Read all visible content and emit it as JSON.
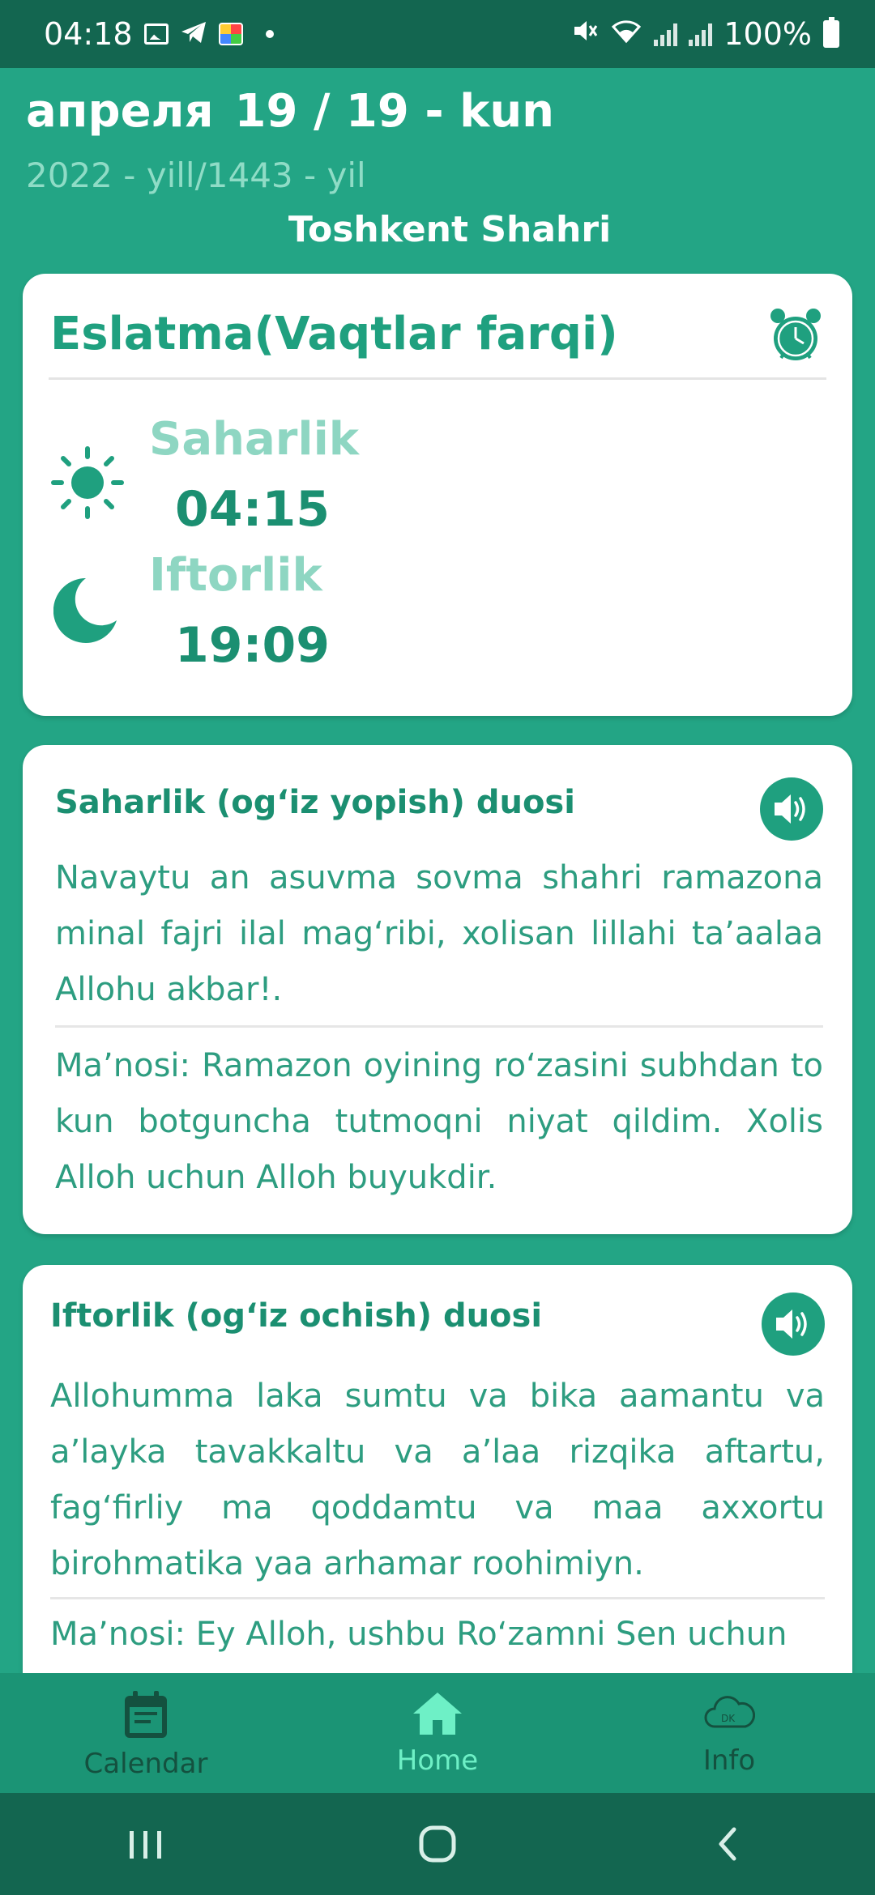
{
  "status_bar": {
    "time": "04:18",
    "battery": "100%",
    "icons": [
      "gallery-icon",
      "telegram-icon",
      "chat-app-icon",
      "notification-dot",
      "mute-icon",
      "wifi-icon",
      "signal-icon",
      "battery-icon"
    ]
  },
  "header": {
    "month": "апреля",
    "day": "19 / 19 - kun",
    "year": "2022 - yill/1443 - yil",
    "city": "Toshkent Shahri"
  },
  "reminder": {
    "title": "Eslatma(Vaqtlar farqi)",
    "saharlik_label": "Saharlik",
    "saharlik_time": "04:15",
    "iftorlik_label": "Iftorlik",
    "iftorlik_time": "19:09"
  },
  "duo_saharlik": {
    "title": "Saharlik (og‘iz yopish) duosi",
    "text": "Navaytu an asuvma sovma shahri ramazona minal fajri ilal mag‘ribi, xolisan lillahi ta’aalaa Allohu akbar!.",
    "meaning": "Ma’nosi: Ramazon oyining ro‘zasini subhdan to kun botguncha tutmoqni niyat qildim. Xolis Alloh uchun Alloh buyukdir."
  },
  "duo_iftorlik": {
    "title": "Iftorlik (og‘iz ochish) duosi",
    "text": "Allohumma laka sumtu va bika aamantu va a’layka tavakkaltu va a’laa rizqika aftartu, fag‘firliy ma qoddamtu va maa axxortu birohmatika yaa arhamar roohimiyn.",
    "meaning": "Ma’nosi: Ey Alloh, ushbu Ro‘zamni Sen uchun"
  },
  "bottom_nav": {
    "items": [
      {
        "label": "Calendar",
        "icon": "calendar-icon"
      },
      {
        "label": "Home",
        "icon": "home-icon"
      },
      {
        "label": "Info",
        "icon": "cloud-icon"
      }
    ],
    "active": "Home"
  },
  "colors": {
    "primary": "#23a585",
    "dark": "#136650",
    "accent_text": "#1fa07f",
    "label_light": "#8ed6c2",
    "nav_active": "#6ef0c6"
  }
}
